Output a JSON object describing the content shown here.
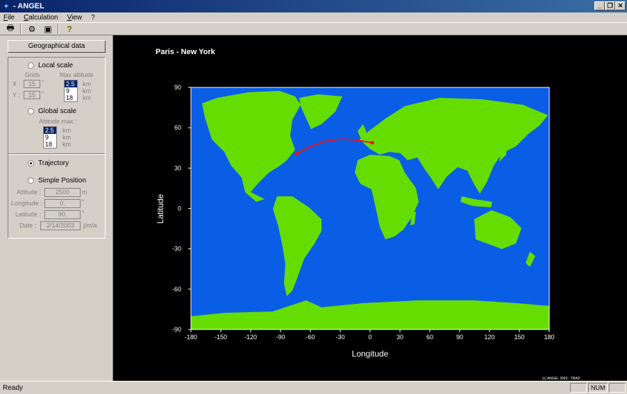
{
  "window": {
    "title": "- ANGEL",
    "minimize": "_",
    "restore": "❐",
    "close": "✕"
  },
  "menu": [
    "File",
    "Calculation",
    "View",
    "?"
  ],
  "toolbar": {
    "print": "🖶",
    "tool2": "⚙",
    "tool3": "▣",
    "help": "?"
  },
  "left": {
    "geo_button": "Geographical data",
    "local_scale": "Local scale",
    "grids_label": "Grids",
    "max_altitude_label": "Max altitude",
    "x_label": "X :",
    "x_value": "15",
    "y_label": "Y :",
    "y_value": "15",
    "deg": "°",
    "local_altitudes": [
      "2.5",
      "9",
      "18"
    ],
    "km": "km",
    "global_scale": "Global scale",
    "altitude_max_label": "Altitude max :",
    "global_altitudes": [
      "2.5",
      "9",
      "18"
    ],
    "trajectory": "Trajectory",
    "simple_position": "Simple Position",
    "altitude_label": "Altitude :",
    "altitude_value": "2500",
    "altitude_unit": "m",
    "longitude_label": "Longitude :",
    "longitude_value": "0.",
    "latitude_label": "Latitude :",
    "latitude_value": "90.",
    "date_label": "Date :",
    "date_value": "2/14/2003",
    "date_format": "j/m/a"
  },
  "plot": {
    "title": "Paris - New York",
    "xlabel": "Longitude",
    "ylabel": "Latitude",
    "copyright": "(c) ANGEL 2003 - TRAD",
    "ocean_color": "#0a5ee6",
    "land_color": "#66dd00",
    "route_color": "#ee1111"
  },
  "chart_data": {
    "type": "line",
    "title": "Paris - New York",
    "xlabel": "Longitude",
    "ylabel": "Latitude",
    "xlim": [
      -180,
      180
    ],
    "ylim": [
      -90,
      90
    ],
    "xticks": [
      -180,
      -150,
      -120,
      -90,
      -60,
      -30,
      0,
      30,
      60,
      90,
      120,
      150,
      180
    ],
    "yticks": [
      90,
      60,
      30,
      0,
      -30,
      -60,
      -90
    ],
    "series": [
      {
        "x": [
          -74,
          -60,
          -45,
          -30,
          -15,
          2.3
        ],
        "y": [
          40.7,
          46,
          50,
          51.5,
          51,
          48.8
        ]
      }
    ]
  },
  "status": {
    "text": "Ready",
    "num": "NUM"
  }
}
